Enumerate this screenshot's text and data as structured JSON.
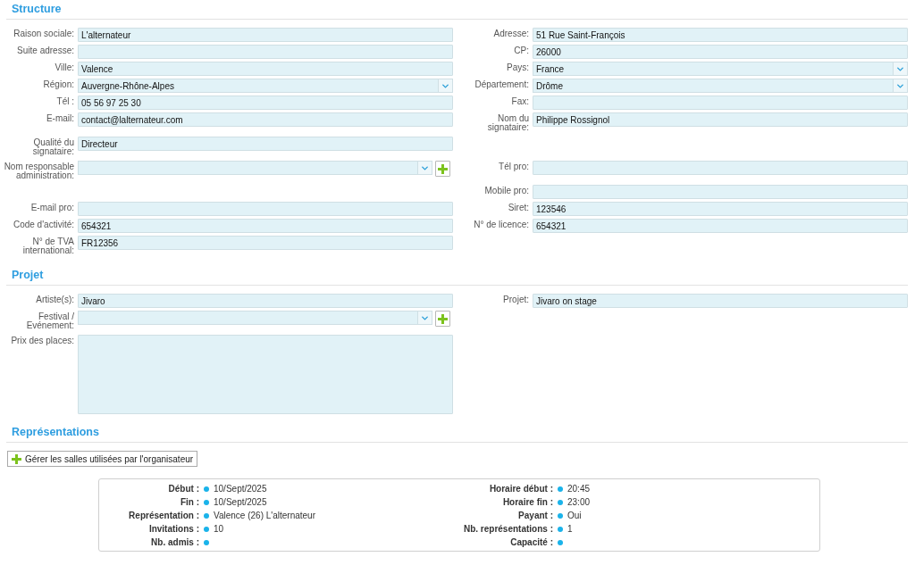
{
  "structure": {
    "title": "Structure",
    "rows": [
      {
        "left": {
          "kind": "text",
          "label": "Raison sociale:",
          "value": "L'alternateur"
        },
        "right": {
          "kind": "text",
          "label": "Adresse:",
          "value": "51 Rue Saint-François"
        }
      },
      {
        "left": {
          "kind": "text",
          "label": "Suite adresse:"
        },
        "right": {
          "kind": "text",
          "label": "CP:",
          "value": "26000"
        }
      },
      {
        "left": {
          "kind": "text",
          "label": "Ville:",
          "value": "Valence"
        },
        "right": {
          "kind": "select",
          "label": "Pays:",
          "value": "France"
        }
      },
      {
        "left": {
          "kind": "select",
          "label": "Région:",
          "value": "Auvergne-Rhône-Alpes"
        },
        "right": {
          "kind": "select",
          "label": "Département:",
          "value": "Drôme"
        }
      },
      {
        "left": {
          "kind": "text",
          "label": "Tél :",
          "value": "05 56 97 25 30"
        },
        "right": {
          "kind": "text",
          "label": "Fax:"
        }
      },
      {
        "left": {
          "kind": "text",
          "label": "E-mail:",
          "value": "contact@lalternateur.com"
        },
        "right": {
          "kind": "text",
          "label": "Nom du signataire:",
          "value": "Philippe Rossignol"
        }
      },
      {
        "left": {
          "kind": "text",
          "label": "Qualité du signataire:",
          "value": "Directeur"
        }
      },
      {
        "left": {
          "kind": "select_add",
          "label": "Nom responsable administration:"
        },
        "right": {
          "kind": "text",
          "label": "Tél pro:"
        }
      },
      {
        "right": {
          "kind": "text",
          "label": "Mobile pro:"
        }
      },
      {
        "left": {
          "kind": "text",
          "label": "E-mail pro:"
        },
        "right": {
          "kind": "text",
          "label": "Siret:",
          "value": "123546"
        }
      },
      {
        "left": {
          "kind": "text",
          "label": "Code d'activité:",
          "value": "654321"
        },
        "right": {
          "kind": "text",
          "label": "N° de licence:",
          "value": "654321"
        }
      },
      {
        "left": {
          "kind": "text",
          "label": "N° de TVA international:",
          "value": "FR12356"
        }
      }
    ]
  },
  "projet": {
    "title": "Projet",
    "rows": [
      {
        "left": {
          "kind": "text",
          "label": "Artiste(s):",
          "value": "Jivaro"
        },
        "right": {
          "kind": "text",
          "label": "Projet:",
          "value": "Jivaro on stage"
        }
      },
      {
        "left": {
          "kind": "select_add",
          "label": "Festival / Evénement:"
        }
      },
      {
        "left": {
          "kind": "textarea",
          "label": "Prix des places:"
        }
      }
    ]
  },
  "representations": {
    "title": "Représentations",
    "button": "Gérer les salles utilisées par l'organisateur",
    "details": [
      {
        "left": {
          "label": "Début :",
          "value": "10/Sept/2025"
        },
        "right": {
          "label": "Horaire début :",
          "value": "20:45"
        }
      },
      {
        "left": {
          "label": "Fin :",
          "value": "10/Sept/2025"
        },
        "right": {
          "label": "Horaire fin :",
          "value": "23:00"
        }
      },
      {
        "left": {
          "label": "Représentation :",
          "value": "Valence (26) L'alternateur"
        },
        "right": {
          "label": "Payant :",
          "value": "Oui"
        }
      },
      {
        "left": {
          "label": "Invitations :",
          "value": "10"
        },
        "right": {
          "label": "Nb. représentations :",
          "value": "1"
        }
      },
      {
        "left": {
          "label": "Nb. admis :"
        },
        "right": {
          "label": "Capacité :"
        }
      }
    ]
  }
}
